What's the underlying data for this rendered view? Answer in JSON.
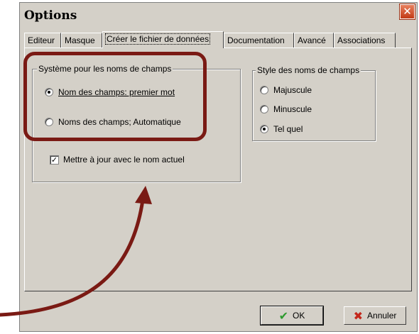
{
  "window": {
    "title": "Options"
  },
  "tabs": [
    {
      "label": "Editeur",
      "active": false
    },
    {
      "label": "Masque",
      "active": false
    },
    {
      "label": "Créer le fichier de données",
      "active": true
    },
    {
      "label": "Documentation",
      "active": false
    },
    {
      "label": "Avancé",
      "active": false
    },
    {
      "label": "Associations",
      "active": false
    }
  ],
  "field_system_group": {
    "label": "Système pour les noms de champs",
    "options": [
      {
        "label": "Nom des champs: premier mot",
        "selected": true
      },
      {
        "label": "Noms des champs; Automatique",
        "selected": false
      }
    ],
    "checkbox": {
      "label": "Mettre à jour avec le nom actuel",
      "checked": true
    }
  },
  "style_group": {
    "label": "Style des noms de champs",
    "options": [
      {
        "label": "Majuscule",
        "selected": false
      },
      {
        "label": "Minuscule",
        "selected": false
      },
      {
        "label": "Tel quel",
        "selected": true
      }
    ]
  },
  "buttons": {
    "ok": "OK",
    "cancel": "Annuler"
  },
  "colors": {
    "annotation": "#7a1a14",
    "dialog_bg": "#d4d0c8",
    "close_button": "#c23a16"
  },
  "icons": {
    "close": "close-icon",
    "ok": "check-icon",
    "cancel": "x-icon"
  }
}
